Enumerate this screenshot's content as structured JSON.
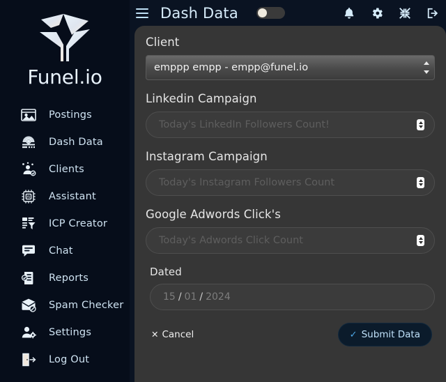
{
  "brand": {
    "name": "Funel.io",
    "logo_icon": "funnel-check-logo"
  },
  "sidebar": {
    "items": [
      {
        "label": "Postings",
        "icon": "image-window-icon"
      },
      {
        "label": "Dash Data",
        "icon": "dashboard-gear-icon"
      },
      {
        "label": "Clients",
        "icon": "user-check-icon"
      },
      {
        "label": "Assistant",
        "icon": "ai-chip-icon"
      },
      {
        "label": "ICP Creator",
        "icon": "funnel-document-icon"
      },
      {
        "label": "Chat",
        "icon": "chat-bubble-icon"
      },
      {
        "label": "Reports",
        "icon": "report-check-icon"
      },
      {
        "label": "Spam Checker",
        "icon": "spam-envelope-icon"
      },
      {
        "label": "Settings",
        "icon": "user-gear-icon"
      },
      {
        "label": "Log Out",
        "icon": "logout-door-icon"
      }
    ]
  },
  "topbar": {
    "menu_icon": "hamburger-icon",
    "title": "Dash Data",
    "theme_toggle": {
      "state": "off"
    },
    "actions": [
      {
        "name": "notifications",
        "icon": "bell-icon"
      },
      {
        "name": "settings",
        "icon": "gear-icon"
      },
      {
        "name": "compress",
        "icon": "compress-arrows-icon"
      },
      {
        "name": "logout",
        "icon": "logout-icon"
      }
    ]
  },
  "form": {
    "client": {
      "label": "Client",
      "selected": "emppp empp - empp@funel.io",
      "options": [
        "emppp empp - empp@funel.io"
      ]
    },
    "linkedin": {
      "label": "Linkedin Campaign",
      "value": "",
      "placeholder": "Today's LinkedIn Followers Count!"
    },
    "instagram": {
      "label": "Instagram Campaign",
      "value": "",
      "placeholder": "Today's Instagram Followers Count"
    },
    "adwords": {
      "label": "Google Adwords Click's",
      "value": "",
      "placeholder": "Today's Adwords Click Count"
    },
    "dated": {
      "label": "Dated",
      "day": "15",
      "month": "01",
      "year": "2024",
      "separator": "/"
    },
    "cancel_label": "Cancel",
    "cancel_icon": "x-icon",
    "submit_label": "Submit Data",
    "submit_icon": "check-icon"
  },
  "colors": {
    "sidebar_bg": "#060d1a",
    "page_bg": "#0a1322",
    "panel_bg": "#363636",
    "accent": "#4ea8e8",
    "submit_bg": "#0b1b2b",
    "label_text": "#e6e6e6",
    "nav_text": "#cfe3f2"
  }
}
